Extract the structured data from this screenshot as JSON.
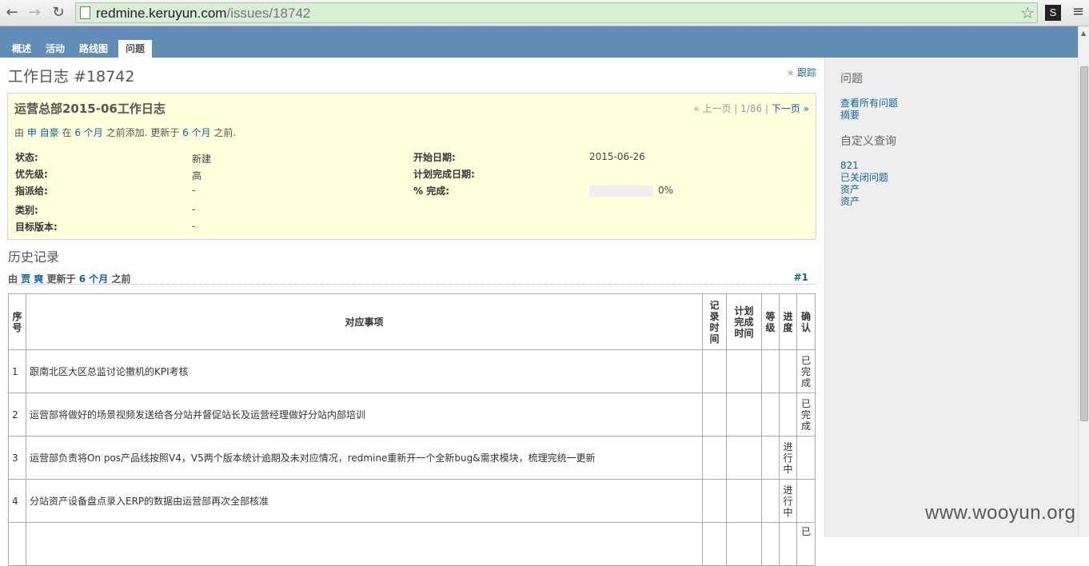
{
  "browser": {
    "url_host": "redmine.keruyun.com",
    "url_path": "/issues/18742",
    "ext_label": "S"
  },
  "header": {
    "tabs": [
      "概述",
      "活动",
      "路线图",
      "问题"
    ],
    "selected_tab": "问题"
  },
  "issue": {
    "heading": "工作日志 #18742",
    "watch_label": "跟踪",
    "subject": "运营总部2015-06工作日志",
    "pager": {
      "prev": "« 上一页",
      "position": "1/86",
      "next": "下一页 »",
      "sep": "|"
    },
    "author_line": {
      "by": "由",
      "author": "申 自豪",
      "at": "在",
      "added_ago": "6 个月",
      "added_suffix": "之前添加. 更新于",
      "updated_ago": "6 个月",
      "updated_suffix": "之前."
    },
    "attributes": {
      "status_label": "状态:",
      "status": "新建",
      "priority_label": "优先级:",
      "priority": "高",
      "assignee_label": "指派给:",
      "assignee": "-",
      "category_label": "类别:",
      "category": "-",
      "version_label": "目标版本:",
      "version": "-",
      "start_label": "开始日期:",
      "start": "2015-06-26",
      "due_label": "计划完成日期:",
      "due": "",
      "done_label": "% 完成:",
      "done": "0%",
      "done_fraction": 0
    }
  },
  "history": {
    "heading": "历史记录",
    "by": "由",
    "user": "贾 爽",
    "updated": "更新于",
    "ago": "6 个月",
    "suffix": "之前",
    "journal_number": "#1"
  },
  "table": {
    "headers": [
      "序号",
      "对应事项",
      "记录时间",
      "计划完成时间",
      "等级",
      "进度",
      "确认"
    ],
    "rows": [
      {
        "num": "1",
        "item": "跟南北区大区总监讨论撤机的KPI考核",
        "progress": "",
        "confirm": "已完成"
      },
      {
        "num": "2",
        "item": "运营部将做好的场景视频发送给各分站并督促站长及运营经理做好分站内部培训",
        "progress": "",
        "confirm": "已完成"
      },
      {
        "num": "3",
        "item": "运营部负责将On pos产品线按照V4，V5两个版本统计逾期及未对应情况，redmine重新开一个全新bug&需求模块，梳理完统一更新",
        "progress": "进行中",
        "confirm": ""
      },
      {
        "num": "4",
        "item": "分站资产设备盘点录入ERP的数据由运营部再次全部核准",
        "progress": "进行中",
        "confirm": ""
      },
      {
        "num": "",
        "item": "",
        "progress": "",
        "confirm": "已"
      }
    ]
  },
  "sidebar": {
    "issues_heading": "问题",
    "issues_links": [
      "查看所有问题",
      "摘要"
    ],
    "queries_heading": "自定义查询",
    "queries_links": [
      "821",
      "已关闭问题",
      "资产",
      "资产"
    ]
  },
  "watermark": "www.wooyun.org"
}
